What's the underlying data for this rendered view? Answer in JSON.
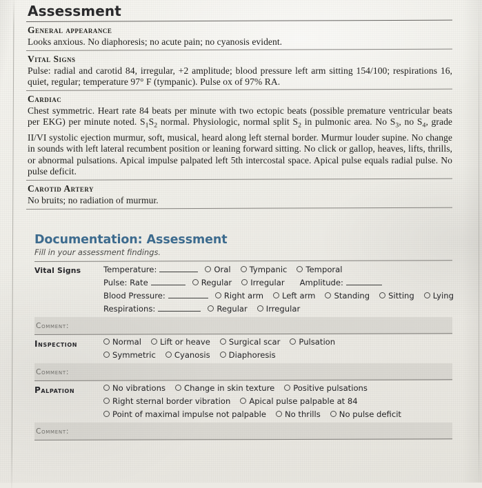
{
  "book": {
    "title": "Assessment",
    "sections": [
      {
        "heading": "General appearance",
        "body": "Looks anxious. No diaphoresis; no acute pain; no cyanosis evident."
      },
      {
        "heading": "Vital Signs",
        "body": "Pulse: radial and carotid 84, irregular, +2 amplitude; blood pressure left arm sitting 154/100; respirations 16, quiet, regular; temperature 97° F (tympanic). Pulse ox of 97% RA."
      },
      {
        "heading": "Cardiac",
        "body": "Chest symmetric. Heart rate 84 beats per minute with two ectopic beats (possible premature ventricular beats per EKG) per minute noted. S1S2 normal. Physiologic, normal split S2 in pulmonic area. No S3, no S4, grade II/VI systolic ejection murmur, soft, musical, heard along left sternal border. Murmur louder supine. No change in sounds with left lateral recumbent position or leaning forward sitting. No click or gallop, heaves, lifts, thrills, or abnormal pulsations. Apical impulse palpated left 5th intercostal space. Apical pulse equals radial pulse. No pulse deficit."
      },
      {
        "heading": "Carotid Artery",
        "body": "No bruits; no radiation of murmur."
      }
    ]
  },
  "documentation": {
    "title": "Documentation: Assessment",
    "subtitle": "Fill in your assessment findings.",
    "comment_label": "Comment:",
    "sections": [
      {
        "label": "Vital Signs",
        "label_style": "mixed",
        "lines": [
          {
            "field": "Temperature:",
            "blank_width": 56,
            "options": [
              "Oral",
              "Tympanic",
              "Temporal"
            ]
          },
          {
            "field": "Pulse: Rate",
            "blank_width": 50,
            "options": [
              "Regular",
              "Irregular"
            ],
            "trailing_field": "Amplitude:",
            "trailing_blank_width": 52
          },
          {
            "field": "Blood Pressure:",
            "blank_width": 58,
            "options": [
              "Right arm",
              "Left arm",
              "Standing",
              "Sitting",
              "Lying"
            ]
          },
          {
            "field": "Respirations:",
            "blank_width": 62,
            "options": [
              "Regular",
              "Irregular"
            ]
          }
        ]
      },
      {
        "label": "Inspection",
        "label_style": "caps",
        "option_rows": [
          [
            "Normal",
            "Lift or heave",
            "Surgical scar",
            "Pulsation"
          ],
          [
            "Symmetric",
            "Cyanosis",
            "Diaphoresis"
          ]
        ]
      },
      {
        "label": "Palpation",
        "label_style": "caps",
        "option_rows": [
          [
            "No vibrations",
            "Change in skin texture",
            "Positive pulsations"
          ],
          [
            "Right sternal border vibration",
            "Apical pulse palpable at 84"
          ],
          [
            "Point of maximal impulse not palpable",
            "No thrills",
            "No pulse deficit"
          ]
        ]
      }
    ]
  },
  "colors": {
    "heading_blue": "#3d6b8e",
    "text": "#232326",
    "rule": "#4c4a48",
    "comment_label": "#6d6c68"
  }
}
